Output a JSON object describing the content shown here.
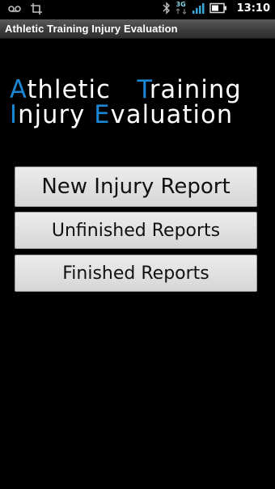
{
  "status_bar": {
    "time": "13:10",
    "network_type": "3G",
    "icons": [
      "voicemail-icon",
      "screenshot-crop-icon",
      "bluetooth-icon",
      "data-arrows-icon",
      "signal-icon",
      "battery-icon"
    ],
    "accent_color": "#8fd3e8"
  },
  "title_bar": {
    "title": "Athletic Training Injury Evaluation"
  },
  "logo": {
    "line1": {
      "word1_initial": "A",
      "word1_rest": "thletic",
      "word2_initial": "T",
      "word2_rest": "raining"
    },
    "line2": {
      "word1_initial": "I",
      "word1_rest": "njury",
      "word2_initial": "E",
      "word2_rest": "valuation"
    },
    "accent_color": "#1b86d4",
    "text_color": "#ffffff"
  },
  "menu": {
    "new_report_label": "New Injury Report",
    "unfinished_label": "Unfinished Reports",
    "finished_label": "Finished Reports"
  },
  "colors": {
    "background": "#000000",
    "button_face": "#e2e2e2",
    "button_text": "#111111"
  }
}
